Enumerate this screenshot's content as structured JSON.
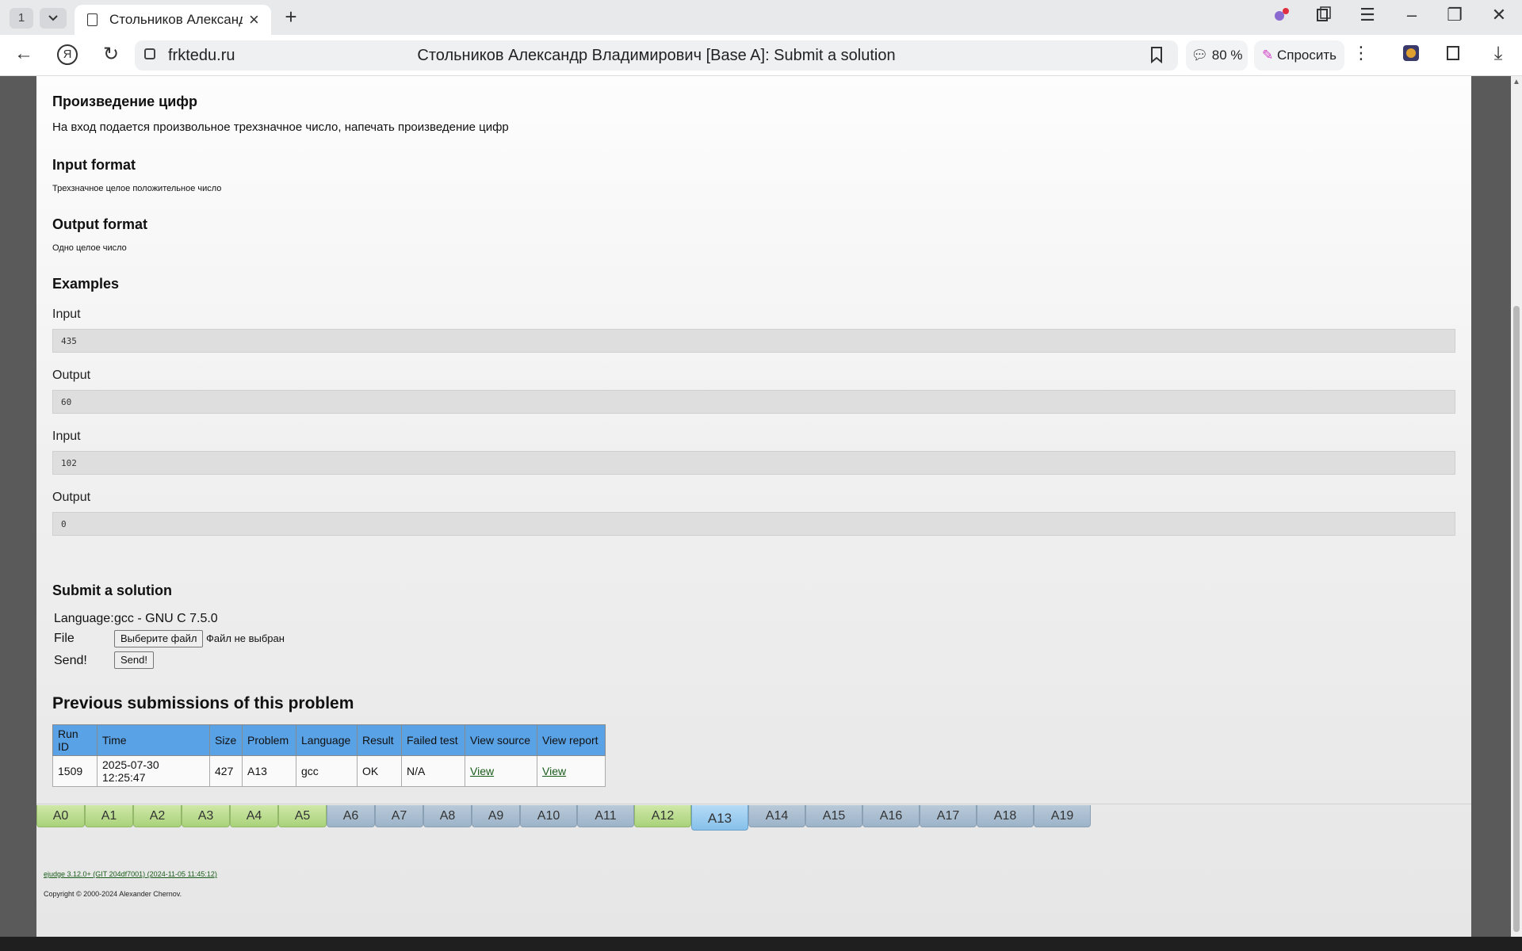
{
  "browser": {
    "tab_count": "1",
    "tab_title": "Стольников Александр Владимирович [Base A]: Submit a solution",
    "domain": "frktedu.ru",
    "page_title": "Стольников Александр Владимирович [Base A]: Submit a solution",
    "zoom": "80 %",
    "ask_label": "Спросить"
  },
  "problem": {
    "title": "Произведение цифр",
    "statement": "На вход подается произвольное трехзначное число, напечать произведение цифр",
    "input_format_heading": "Input format",
    "input_format": "Трехзначное целое положительное число",
    "output_format_heading": "Output format",
    "output_format": "Одно целое число",
    "examples_heading": "Examples",
    "examples": [
      {
        "input_label": "Input",
        "input": "435",
        "output_label": "Output",
        "output": "60"
      },
      {
        "input_label": "Input",
        "input": "102",
        "output_label": "Output",
        "output": "0"
      }
    ]
  },
  "submit": {
    "heading": "Submit a solution",
    "language_label": "Language:",
    "language_value": "gcc - GNU C 7.5.0",
    "file_label": "File",
    "file_button": "Выберите файл",
    "file_status": "Файл не выбран",
    "send_label": "Send!",
    "send_button": "Send!"
  },
  "previous": {
    "heading": "Previous submissions of this problem",
    "columns": [
      "Run ID",
      "Time",
      "Size",
      "Problem",
      "Language",
      "Result",
      "Failed test",
      "View source",
      "View report"
    ],
    "rows": [
      [
        "1509",
        "2025-07-30 12:25:47",
        "427",
        "A13",
        "gcc",
        "OK",
        "N/A",
        "View",
        "View"
      ]
    ]
  },
  "problem_tabs": [
    {
      "label": "A0",
      "status": "ok"
    },
    {
      "label": "A1",
      "status": "ok"
    },
    {
      "label": "A2",
      "status": "ok"
    },
    {
      "label": "A3",
      "status": "ok"
    },
    {
      "label": "A4",
      "status": "ok"
    },
    {
      "label": "A5",
      "status": "ok"
    },
    {
      "label": "A6",
      "status": "none"
    },
    {
      "label": "A7",
      "status": "none"
    },
    {
      "label": "A8",
      "status": "none"
    },
    {
      "label": "A9",
      "status": "none"
    },
    {
      "label": "A10",
      "status": "none"
    },
    {
      "label": "A11",
      "status": "none"
    },
    {
      "label": "A12",
      "status": "ok"
    },
    {
      "label": "A13",
      "status": "current"
    },
    {
      "label": "A14",
      "status": "none"
    },
    {
      "label": "A15",
      "status": "none"
    },
    {
      "label": "A16",
      "status": "none"
    },
    {
      "label": "A17",
      "status": "none"
    },
    {
      "label": "A18",
      "status": "none"
    },
    {
      "label": "A19",
      "status": "none"
    }
  ],
  "footer": {
    "version": "ejudge 3.12.0+ (GIT 204df7001) (2024-11-05 11:45:12)",
    "copyright": "Copyright © 2000-2024 Alexander Chernov."
  },
  "colors": {
    "tab_ok": "#a9d27a",
    "tab_none": "#9cb3c8",
    "tab_current": "#86c0ea",
    "table_header": "#5aa2e6"
  }
}
